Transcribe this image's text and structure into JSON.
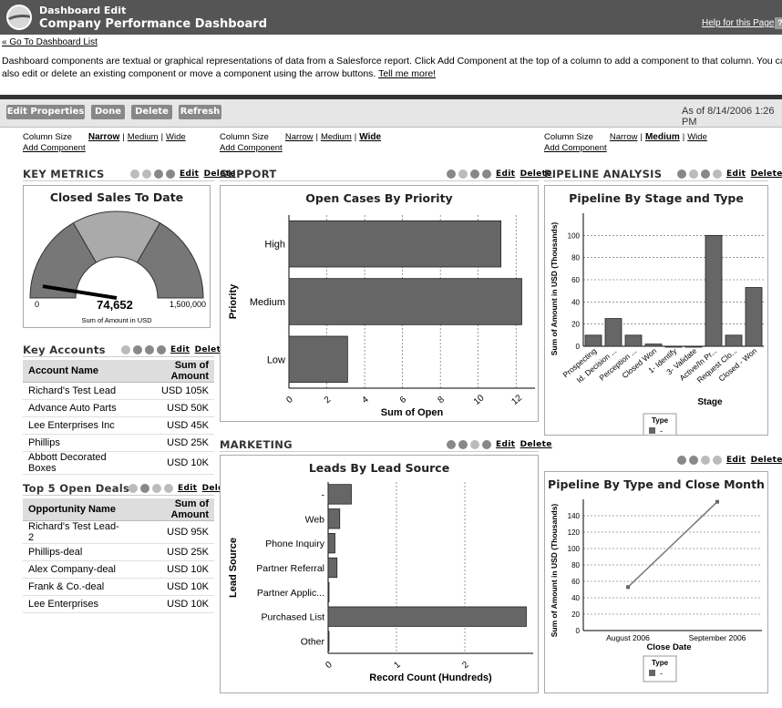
{
  "header": {
    "line1": "Dashboard Edit",
    "line2": "Company Performance Dashboard",
    "help": "Help for this Page",
    "help_icon_glyph": "?"
  },
  "nav": {
    "goto": "« Go To Dashboard List"
  },
  "description": {
    "text": "Dashboard components are textual or graphical representations of data from a Salesforce report. Click Add Component at the top of a column to add a component to that column. You can also edit or delete an existing component or move a component using the arrow buttons.",
    "link": "Tell me more!"
  },
  "toolbar": {
    "edit_properties": "Edit Properties",
    "done": "Done",
    "delete": "Delete",
    "refresh": "Refresh",
    "as_of": "As of 8/14/2006 1:26 PM"
  },
  "column_size": {
    "label": "Column Size",
    "narrow": "Narrow",
    "medium": "Medium",
    "wide": "Wide",
    "add": "Add Component"
  },
  "controls": {
    "edit": "Edit",
    "delete": "Delete"
  },
  "sections": {
    "key_metrics": "KEY METRICS",
    "support": "SUPPORT",
    "pipeline": "PIPELINE ANALYSIS",
    "marketing": "MARKETING",
    "key_accounts": "Key Accounts",
    "top_deals": "Top 5 Open Deals"
  },
  "gauge": {
    "title": "Closed Sales To Date",
    "value": 74652,
    "value_label": "74,652",
    "min_label": "0",
    "max": 1500000,
    "max_label": "1,500,000",
    "caption": "Sum of Amount in USD",
    "needle_fraction": 0.05
  },
  "key_accounts": {
    "headers": [
      "Account Name",
      "Sum of Amount"
    ],
    "rows": [
      [
        "Richard's Test Lead",
        "USD 105K"
      ],
      [
        "Advance Auto Parts",
        "USD 50K"
      ],
      [
        "Lee Enterprises Inc",
        "USD 45K"
      ],
      [
        "Phillips",
        "USD 25K"
      ],
      [
        "Abbott Decorated Boxes",
        "USD 10K"
      ]
    ]
  },
  "top_deals": {
    "headers": [
      "Opportunity Name",
      "Sum of Amount"
    ],
    "rows": [
      [
        "Richard's Test Lead-2",
        "USD 95K"
      ],
      [
        "Phillips-deal",
        "USD 25K"
      ],
      [
        "Alex Company-deal",
        "USD 10K"
      ],
      [
        "Frank & Co.-deal",
        "USD 10K"
      ],
      [
        "Lee Enterprises",
        "USD 10K"
      ]
    ]
  },
  "chart_data": [
    {
      "id": "open_cases",
      "type": "bar",
      "orientation": "horizontal",
      "title": "Open Cases By Priority",
      "xlabel": "Sum of Open",
      "ylabel": "Priority",
      "categories": [
        "High",
        "Medium",
        "Low"
      ],
      "values": [
        11.2,
        12.3,
        3.1
      ],
      "xlim": [
        0,
        13
      ],
      "xticks": [
        "0",
        "2",
        "4",
        "6",
        "8",
        "10",
        "12"
      ],
      "grid": true
    },
    {
      "id": "leads",
      "type": "bar",
      "orientation": "horizontal",
      "title": "Leads By Lead Source",
      "xlabel": "Record Count (Hundreds)",
      "ylabel": "Lead Source",
      "categories": [
        "-",
        "Web",
        "Phone Inquiry",
        "Partner Referral",
        "Partner Applic...",
        "Purchased List",
        "Other"
      ],
      "values": [
        0.34,
        0.17,
        0.1,
        0.13,
        0.01,
        2.9,
        0.01
      ],
      "xlim": [
        0,
        3
      ],
      "xticks": [
        "0",
        "1",
        "2"
      ],
      "grid": true
    },
    {
      "id": "pipeline_stage",
      "type": "bar",
      "title": "Pipeline By Stage and Type",
      "xlabel": "Stage",
      "ylabel": "Sum of Amount in USD (Thousands)",
      "categories": [
        "Prospecting",
        "Id. Decision ...",
        "Perception ...",
        "Closed Won",
        "1- Identify",
        "3- Validate",
        "Active/In Pr...",
        "Request Clo...",
        "Closed - Won"
      ],
      "values": [
        10,
        25,
        10,
        2,
        0,
        0,
        100,
        10,
        53
      ],
      "ylim": [
        0,
        120
      ],
      "yticks": [
        "0",
        "20",
        "40",
        "60",
        "80",
        "100"
      ],
      "legend": {
        "title": "Type",
        "items": [
          "-"
        ]
      },
      "grid": true
    },
    {
      "id": "pipeline_month",
      "type": "line",
      "title": "Pipeline By Type and Close Month",
      "xlabel": "Close Date",
      "ylabel": "Sum of Amount in USD (Thousands)",
      "categories": [
        "August 2006",
        "September 2006"
      ],
      "values": [
        53,
        157
      ],
      "ylim": [
        0,
        160
      ],
      "yticks": [
        "0",
        "20",
        "40",
        "60",
        "80",
        "100",
        "120",
        "140"
      ],
      "legend": {
        "title": "Type",
        "items": [
          "-"
        ]
      },
      "grid": true
    }
  ],
  "colors": {
    "bar": "#666666",
    "header_bg": "#555555",
    "toolbar_btn": "#888888",
    "gauge_dark": "#777777",
    "gauge_light": "#aaaaaa"
  }
}
